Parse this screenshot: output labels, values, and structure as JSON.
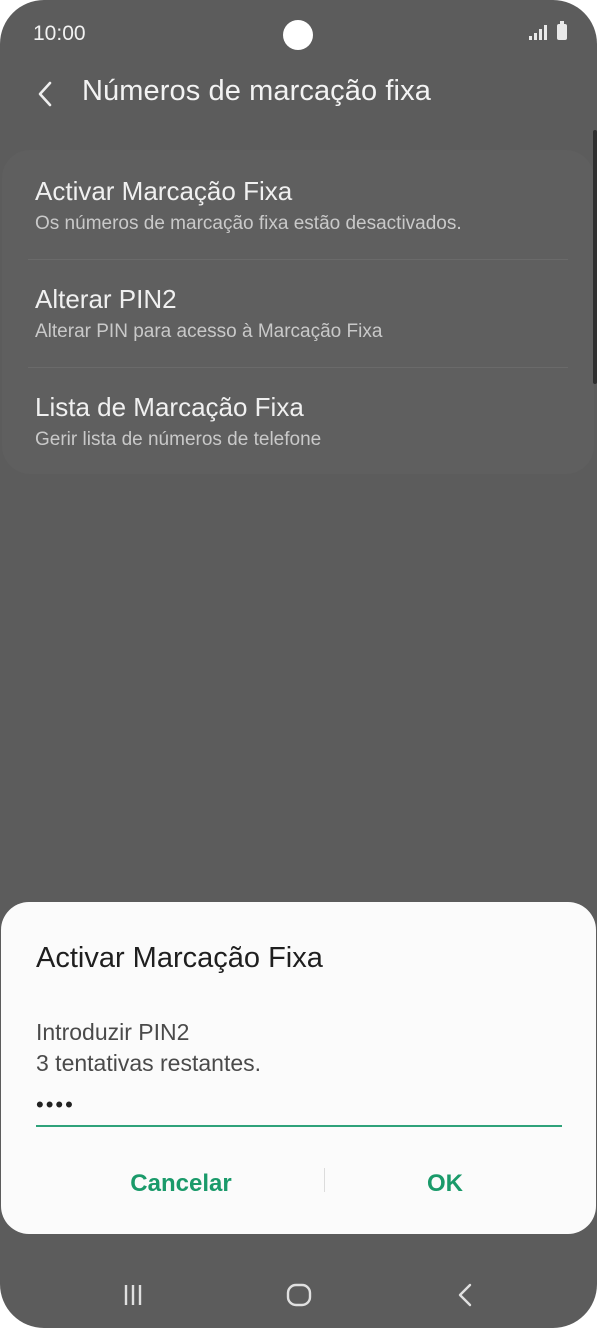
{
  "status_bar": {
    "time": "10:00",
    "icons": [
      "signal-icon",
      "battery-icon"
    ]
  },
  "header": {
    "back_icon": "chevron-left-icon",
    "title": "Números de marcação fixa"
  },
  "settings": [
    {
      "title": "Activar Marcação Fixa",
      "subtitle": "Os números de marcação fixa estão desactivados."
    },
    {
      "title": "Alterar PIN2",
      "subtitle": "Alterar PIN para acesso à Marcação Fixa"
    },
    {
      "title": "Lista de Marcação Fixa",
      "subtitle": "Gerir lista de números de telefone"
    }
  ],
  "dialog": {
    "title": "Activar Marcação Fixa",
    "message_line1": "Introduzir PIN2",
    "message_line2": "3 tentativas restantes.",
    "pin_value": "••••",
    "cancel_label": "Cancelar",
    "ok_label": "OK"
  },
  "nav_bar": {
    "icons": [
      "recent-apps-icon",
      "home-icon",
      "back-icon"
    ]
  },
  "colors": {
    "accent": "#1a9a6a",
    "scrim": "#5c5c5c",
    "dialog_bg": "#fbfbfb"
  }
}
